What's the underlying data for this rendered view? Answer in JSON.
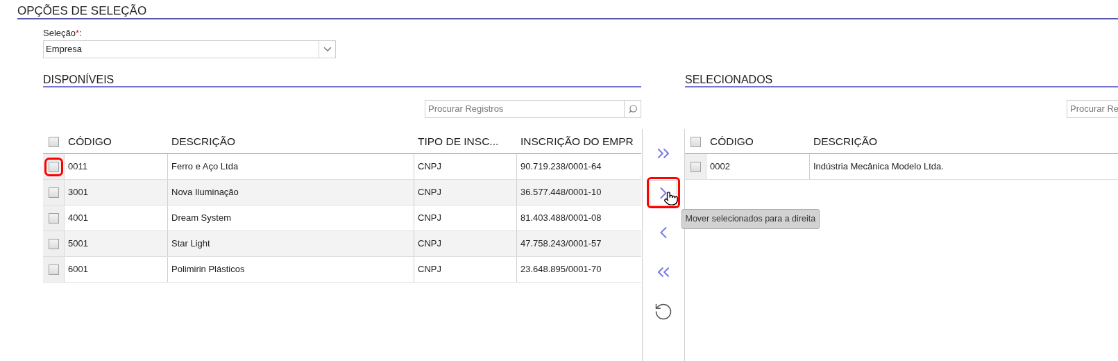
{
  "section_title": "OPÇÕES DE SELEÇÃO",
  "selection": {
    "label": "Seleção",
    "required_mark": "*",
    "suffix": ":",
    "value": "Empresa"
  },
  "available": {
    "title": "DISPONÍVEIS",
    "search": {
      "placeholder": "Procurar Registros"
    },
    "columns": [
      "CÓDIGO",
      "DESCRIÇÃO",
      "TIPO DE INSC...",
      "INSCRIÇÃO DO EMPR"
    ],
    "header_checked": false,
    "rows": [
      {
        "cells": [
          "0011",
          "Ferro e Aço Ltda",
          "CNPJ",
          "90.719.238/0001-64"
        ],
        "checked": false,
        "highlighted": true
      },
      {
        "cells": [
          "3001",
          "Nova Iluminação",
          "CNPJ",
          "36.577.448/0001-10"
        ],
        "checked": false,
        "highlighted": false
      },
      {
        "cells": [
          "4001",
          "Dream System",
          "CNPJ",
          "81.403.488/0001-08"
        ],
        "checked": false,
        "highlighted": false
      },
      {
        "cells": [
          "5001",
          "Star Light",
          "CNPJ",
          "47.758.243/0001-57"
        ],
        "checked": false,
        "highlighted": false
      },
      {
        "cells": [
          "6001",
          "Polimirin Plásticos",
          "CNPJ",
          "23.648.895/0001-70"
        ],
        "checked": false,
        "highlighted": false
      }
    ]
  },
  "move_buttons": [
    {
      "kind": "all_right",
      "highlighted": false,
      "hovered": false
    },
    {
      "kind": "right",
      "highlighted": true,
      "hovered": true,
      "tooltip": "Mover selecionados para a direita"
    },
    {
      "kind": "left",
      "highlighted": false,
      "hovered": false
    },
    {
      "kind": "all_left",
      "highlighted": false,
      "hovered": false
    },
    {
      "kind": "reset",
      "highlighted": false,
      "hovered": false
    }
  ],
  "selected": {
    "title": "SELECIONADOS",
    "search": {
      "placeholder": "Procurar Re"
    },
    "columns": [
      "CÓDIGO",
      "DESCRIÇÃO"
    ],
    "header_checked": false,
    "rows": [
      {
        "cells": [
          "0002",
          "Indústria Mecânica Modelo Ltda."
        ],
        "checked": false,
        "highlighted": false
      }
    ]
  }
}
